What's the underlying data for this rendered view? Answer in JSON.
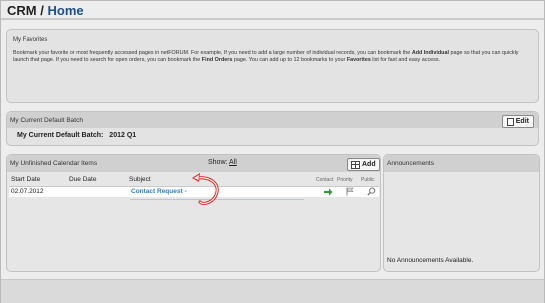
{
  "header": {
    "section": "CRM",
    "separator": "/",
    "page": "Home"
  },
  "favorites": {
    "title": "My Favorites",
    "text_parts": [
      "Bookmark your favorite or most frequently accessed pages in netFORUM. For example, If you need to add a large number of individual records, you can bookmark the ",
      "Add Individual",
      " page so that you can quickly launch that page. If you need to search for open orders, you can bookmark the ",
      "Find Orders",
      " page. You can add up to 12 bookmarks to your ",
      "Favorites",
      " list for fast and easy access."
    ]
  },
  "batch": {
    "title": "My Current Default Batch",
    "edit_label": "Edit",
    "row_label": "My Current Default Batch:",
    "row_value": "2012 Q1"
  },
  "calendar": {
    "title": "My Unfinished Calendar Items",
    "show_label": "Show:",
    "show_value": "All",
    "add_label": "Add",
    "columns": {
      "start_date": "Start Date",
      "due_date": "Due Date",
      "subject": "Subject",
      "contact": "Contact",
      "priority": "Priority",
      "public": "Public"
    },
    "rows": [
      {
        "start_date": "02.07.2012",
        "due_date": "",
        "subject": "Contact Request -"
      }
    ]
  },
  "announcements": {
    "title": "Announcements",
    "empty_text": "No Announcements Available."
  },
  "icons": {
    "contact": "green-arrow-icon",
    "priority": "flag-icon",
    "public": "magnifier-icon",
    "annotation": "curved-red-arrow-icon"
  },
  "colors": {
    "link_blue": "#2b80c8",
    "title_blue": "#1d4f91",
    "arrow_green": "#2e9b2e",
    "annotation_red": "#e0302a"
  }
}
